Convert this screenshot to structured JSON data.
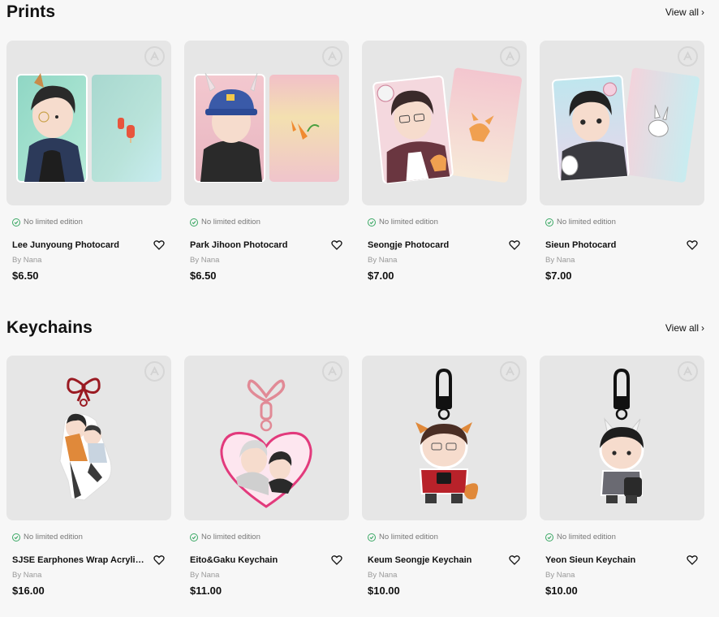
{
  "sections": [
    {
      "title": "Prints",
      "view_all": "View all",
      "products": [
        {
          "edition": "No limited edition",
          "name": "Lee Junyoung Photocard",
          "author": "By Nana",
          "price": "$6.50"
        },
        {
          "edition": "No limited edition",
          "name": "Park Jihoon Photocard",
          "author": "By Nana",
          "price": "$6.50"
        },
        {
          "edition": "No limited edition",
          "name": "Seongje Photocard",
          "author": "By Nana",
          "price": "$7.00"
        },
        {
          "edition": "No limited edition",
          "name": "Sieun Photocard",
          "author": "By Nana",
          "price": "$7.00"
        }
      ]
    },
    {
      "title": "Keychains",
      "view_all": "View all",
      "products": [
        {
          "edition": "No limited edition",
          "name": "SJSE Earphones Wrap Acrylic Keychain",
          "author": "By Nana",
          "price": "$16.00"
        },
        {
          "edition": "No limited edition",
          "name": "Eito&Gaku Keychain",
          "author": "By Nana",
          "price": "$11.00"
        },
        {
          "edition": "No limited edition",
          "name": "Keum Seongje Keychain",
          "author": "By Nana",
          "price": "$10.00"
        },
        {
          "edition": "No limited edition",
          "name": "Yeon Sieun Keychain",
          "author": "By Nana",
          "price": "$10.00"
        }
      ]
    }
  ],
  "icons": {
    "edition": "check-circle-icon",
    "favorite": "heart-outline-icon",
    "view_all": "chevron-right-icon",
    "watermark": "brand-logo-icon"
  },
  "colors": {
    "page_bg": "#f7f7f7",
    "thumb_bg": "#e6e6e6",
    "check_green": "#3aa864"
  }
}
